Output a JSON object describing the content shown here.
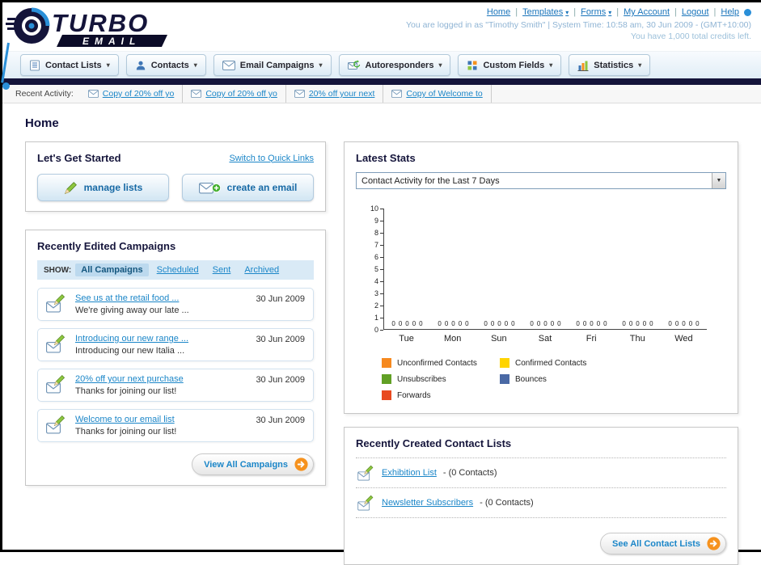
{
  "ui": {
    "dropdown_arrow": "▾",
    "select_arrow": "▼",
    "link_separator": "|",
    "link_color": "#1b86c8",
    "accent_orange": "#f6921e",
    "dark_bar_color": "#14143a"
  },
  "header": {
    "logo_title": "TURBO",
    "logo_subtitle": "EMAIL",
    "links": [
      {
        "label": "Home"
      },
      {
        "label": "Templates",
        "dropdown": true
      },
      {
        "label": "Forms",
        "dropdown": true
      },
      {
        "label": "My Account"
      },
      {
        "label": "Logout"
      },
      {
        "label": "Help"
      }
    ],
    "login_status": "You are logged in as \"Timothy Smith\" | System Time: 10:58 am, 30 Jun 2009 - (GMT+10:00)",
    "credits": "You have 1,000 total credits left."
  },
  "nav": {
    "tabs": [
      {
        "label": "Contact Lists"
      },
      {
        "label": "Contacts"
      },
      {
        "label": "Email Campaigns"
      },
      {
        "label": "Autoresponders"
      },
      {
        "label": "Custom Fields"
      },
      {
        "label": "Statistics"
      }
    ]
  },
  "recent_activity": {
    "label": "Recent Activity:",
    "items": [
      "Copy of 20% off yo",
      "Copy of 20% off yo",
      "20% off your next",
      "Copy of Welcome to"
    ]
  },
  "page_title": "Home",
  "get_started": {
    "title": "Let's Get Started",
    "switch_link": "Switch to Quick Links",
    "manage_lists_label": "manage lists",
    "create_email_label": "create an email"
  },
  "campaigns": {
    "title": "Recently Edited Campaigns",
    "show_label": "SHOW:",
    "tabs": [
      "All Campaigns",
      "Scheduled",
      "Sent",
      "Archived"
    ],
    "active_tab": "All Campaigns",
    "items": [
      {
        "title": "See us at the retail food ...",
        "subtitle": "We're giving away our late ...",
        "date": "30 Jun 2009"
      },
      {
        "title": "Introducing our new range ...",
        "subtitle": "Introducing our new Italia ...",
        "date": "30 Jun 2009"
      },
      {
        "title": "20% off your next purchase",
        "subtitle": "Thanks for joining our list!",
        "date": "30 Jun 2009"
      },
      {
        "title": "Welcome to our email list",
        "subtitle": "Thanks for joining our list!",
        "date": "30 Jun 2009"
      }
    ],
    "view_all_label": "View All Campaigns"
  },
  "stats": {
    "title": "Latest Stats",
    "dropdown_value": "Contact Activity for the Last 7 Days"
  },
  "chart_data": {
    "type": "bar",
    "title": "Contact Activity for the Last 7 Days",
    "categories": [
      "Tue",
      "Mon",
      "Sun",
      "Sat",
      "Fri",
      "Thu",
      "Wed"
    ],
    "series": [
      {
        "name": "Unconfirmed Contacts",
        "color": "#f6891f",
        "values": [
          0,
          0,
          0,
          0,
          0,
          0,
          0
        ]
      },
      {
        "name": "Confirmed Contacts",
        "color": "#ffd400",
        "values": [
          0,
          0,
          0,
          0,
          0,
          0,
          0
        ]
      },
      {
        "name": "Unsubscribes",
        "color": "#61a025",
        "values": [
          0,
          0,
          0,
          0,
          0,
          0,
          0
        ]
      },
      {
        "name": "Bounces",
        "color": "#4a69a5",
        "values": [
          0,
          0,
          0,
          0,
          0,
          0,
          0
        ]
      },
      {
        "name": "Forwards",
        "color": "#e8491f",
        "values": [
          0,
          0,
          0,
          0,
          0,
          0,
          0
        ]
      }
    ],
    "ylim": [
      0,
      10
    ],
    "y_ticks": [
      10,
      9,
      8,
      7,
      6,
      5,
      4,
      3,
      2,
      1,
      0
    ],
    "grid": false,
    "legend_position": "bottom"
  },
  "contact_lists": {
    "title": "Recently Created Contact Lists",
    "items": [
      {
        "name": "Exhibition List",
        "suffix": "- (0 Contacts)"
      },
      {
        "name": "Newsletter Subscribers",
        "suffix": "- (0 Contacts)"
      }
    ],
    "see_all_label": "See All Contact Lists"
  }
}
